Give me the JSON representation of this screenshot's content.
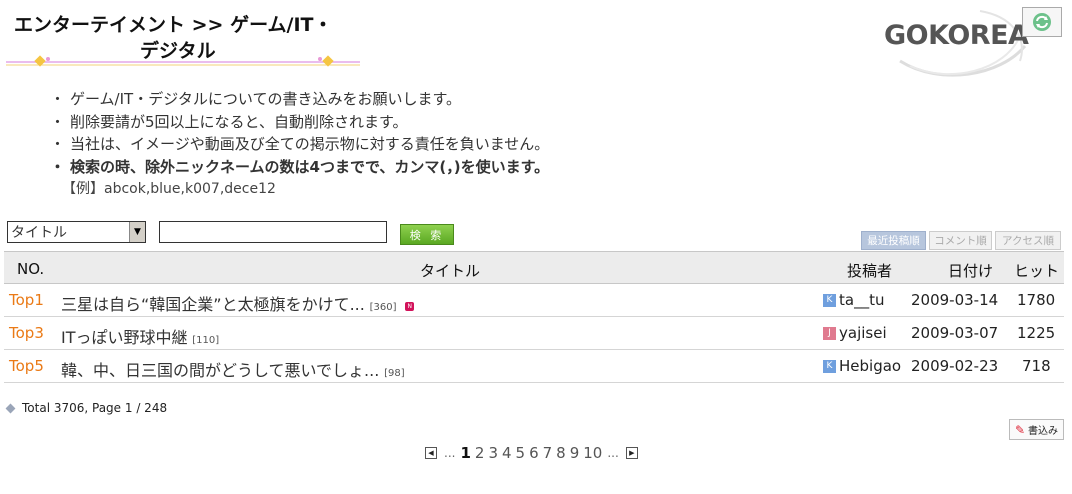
{
  "header": {
    "title_line1": "エンターテイメント >> ゲーム/IT・",
    "title_line2": "デジタル",
    "logo_text": "GOKOREA"
  },
  "notice": {
    "items": [
      "ゲーム/IT・デジタルについての書き込みをお願いします。",
      "削除要請が5回以上になると、自動削除されます。",
      "当社は、イメージや動画及び全ての掲示物に対する責任を負いません。",
      "検索の時、除外ニックネームの数は4つまでで、カンマ(，)を使います。"
    ],
    "bullet": "・",
    "example": "【例】abcok,blue,k007,dece12"
  },
  "search": {
    "select_value": "タイトル",
    "input_value": "",
    "button_label": "検 索"
  },
  "sort_tabs": [
    "最近投稿順",
    "コメント順",
    "アクセス順"
  ],
  "table": {
    "headers": {
      "no": "NO.",
      "title": "タイトル",
      "author": "投稿者",
      "date": "日付け",
      "hits": "ヒット"
    },
    "rows": [
      {
        "no": "Top1",
        "title": "三星は自ら“韓国企業”と太極旗をかけて...",
        "count": "[360]",
        "new": "N",
        "author": "ta__tu",
        "badge": "K",
        "badge_color": "#6f9fde",
        "date": "2009-03-14",
        "hits": "1780"
      },
      {
        "no": "Top3",
        "title": "ITっぽい野球中継",
        "count": "[110]",
        "new": "",
        "author": "yajisei",
        "badge": "J",
        "badge_color": "#e07a8f",
        "date": "2009-03-07",
        "hits": "1225"
      },
      {
        "no": "Top5",
        "title": "韓、中、日三国の間がどうして悪いでしょ...",
        "count": "[98]",
        "new": "",
        "author": "Hebigao",
        "badge": "K",
        "badge_color": "#6f9fde",
        "date": "2009-02-23",
        "hits": "718"
      }
    ]
  },
  "footer": {
    "total": "Total 3706, Page 1 / 248",
    "write_label": "書込み"
  },
  "pager": {
    "dots": "...",
    "pages": [
      "1",
      "2",
      "3",
      "4",
      "5",
      "6",
      "7",
      "8",
      "9",
      "10"
    ],
    "current": "1"
  }
}
